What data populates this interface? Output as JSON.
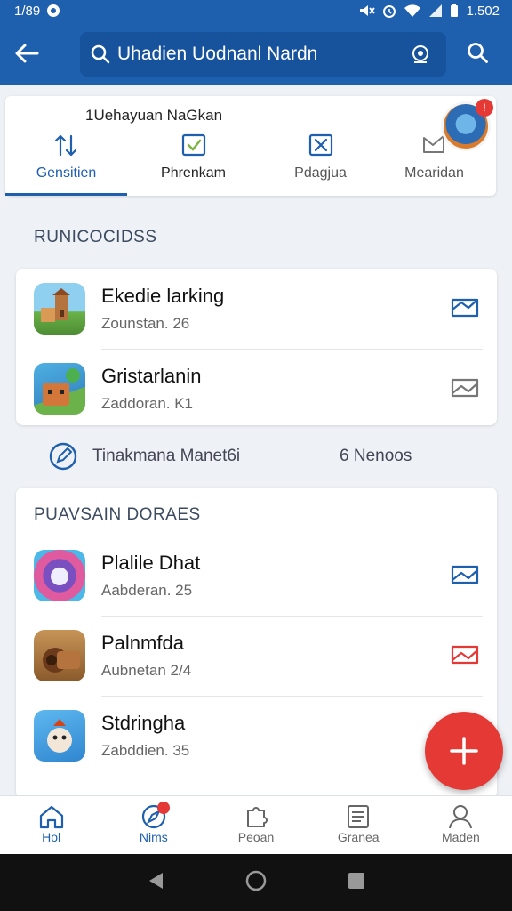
{
  "status": {
    "time": "1/89",
    "battery_text": "1.502"
  },
  "search": {
    "query": "Uhadien Uodnanl Nardn"
  },
  "tabs_header": {
    "title": "1Uehayuan NaGkan"
  },
  "tabs": [
    {
      "label": "Gensitien",
      "icon": "sort-icon",
      "active": true
    },
    {
      "label": "Phrenkam",
      "icon": "check-box-icon",
      "active": false
    },
    {
      "label": "Pdagjua",
      "icon": "x-box-icon",
      "active": false
    },
    {
      "label": "Mearidan",
      "icon": "chat-icon",
      "active": false
    }
  ],
  "section1": {
    "title": "RUNICOCIDSS",
    "items": [
      {
        "title": "Ekedie larking",
        "sub": "Zounstan. 26"
      },
      {
        "title": "Gristarlanin",
        "sub": "Zaddoran. K1"
      }
    ]
  },
  "midbar": {
    "left_label": "Tinakmana Manet6i",
    "right_label": "6 Nenoos"
  },
  "section2": {
    "title": "PUAVSAIN DORAES",
    "items": [
      {
        "title": "Plalile Dhat",
        "sub": "Aabderan. 25"
      },
      {
        "title": "Palnmfda",
        "sub": "Aubnetan 2/4"
      },
      {
        "title": "Stdringha",
        "sub": "Zabddien. 35"
      }
    ]
  },
  "bottom_nav": [
    {
      "label": "Hol",
      "icon": "home-icon",
      "active": true
    },
    {
      "label": "Nims",
      "icon": "compass-icon",
      "active": false
    },
    {
      "label": "Peoan",
      "icon": "puzzle-icon",
      "active": false
    },
    {
      "label": "Granea",
      "icon": "news-icon",
      "active": false
    },
    {
      "label": "Maden",
      "icon": "person-icon",
      "active": false
    }
  ],
  "colors": {
    "primary": "#1e5fae",
    "accent": "#e53935",
    "background": "#eef1f5"
  }
}
